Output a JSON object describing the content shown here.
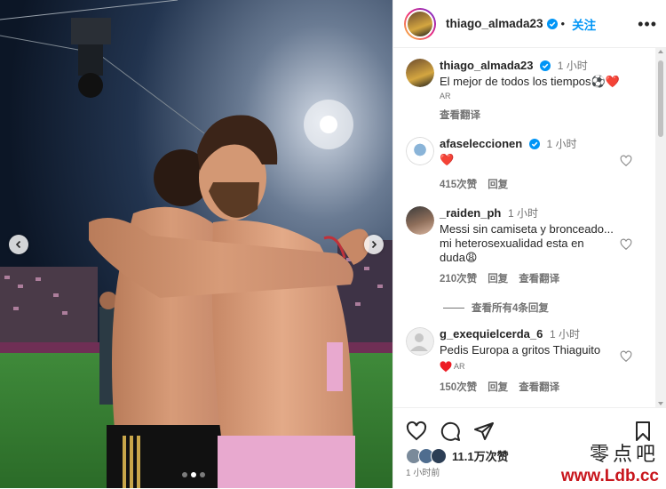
{
  "header": {
    "username": "thiago_almada23",
    "separator": "•",
    "follow_label": "关注",
    "more_label": "•••"
  },
  "caption": {
    "username": "thiago_almada23",
    "time": "1 小时",
    "text": "El mejor de todos los tiempos⚽❤️",
    "badge": "AR",
    "translate_label": "查看翻译"
  },
  "comments": [
    {
      "username": "afaseleccionen",
      "verified": true,
      "time": "1 小时",
      "text": "❤️",
      "likes": "415次赞",
      "reply_label": "回复",
      "translate_label": ""
    },
    {
      "username": "_raiden_ph",
      "verified": false,
      "time": "1 小时",
      "text_lines": [
        "Messi sin camiseta y bronceado...",
        "mi heterosexualidad esta en",
        "duda😩"
      ],
      "likes": "210次赞",
      "reply_label": "回复",
      "translate_label": "查看翻译"
    },
    {
      "username": "g_exequielcerda_6",
      "verified": false,
      "time": "1 小时",
      "text": "Pedis Europa a gritos Thiaguito",
      "badge": "AR",
      "likes": "150次赞",
      "reply_label": "回复",
      "translate_label": "查看翻译"
    }
  ],
  "view_all_replies": "查看所有4条回复",
  "post": {
    "likes_count": "11.1万次赞",
    "posted_time": "1 小时前"
  },
  "watermark": {
    "chinese": "零点吧",
    "url": "www.Ldb.cc"
  },
  "colors": {
    "accent": "#0095f6",
    "heart": "#ed4956",
    "watermark_red": "#c8161d"
  },
  "icons": [
    "heart-icon",
    "comment-icon",
    "share-icon",
    "bookmark-icon",
    "more-icon",
    "verified-icon",
    "chevron-left-icon",
    "chevron-right-icon"
  ]
}
